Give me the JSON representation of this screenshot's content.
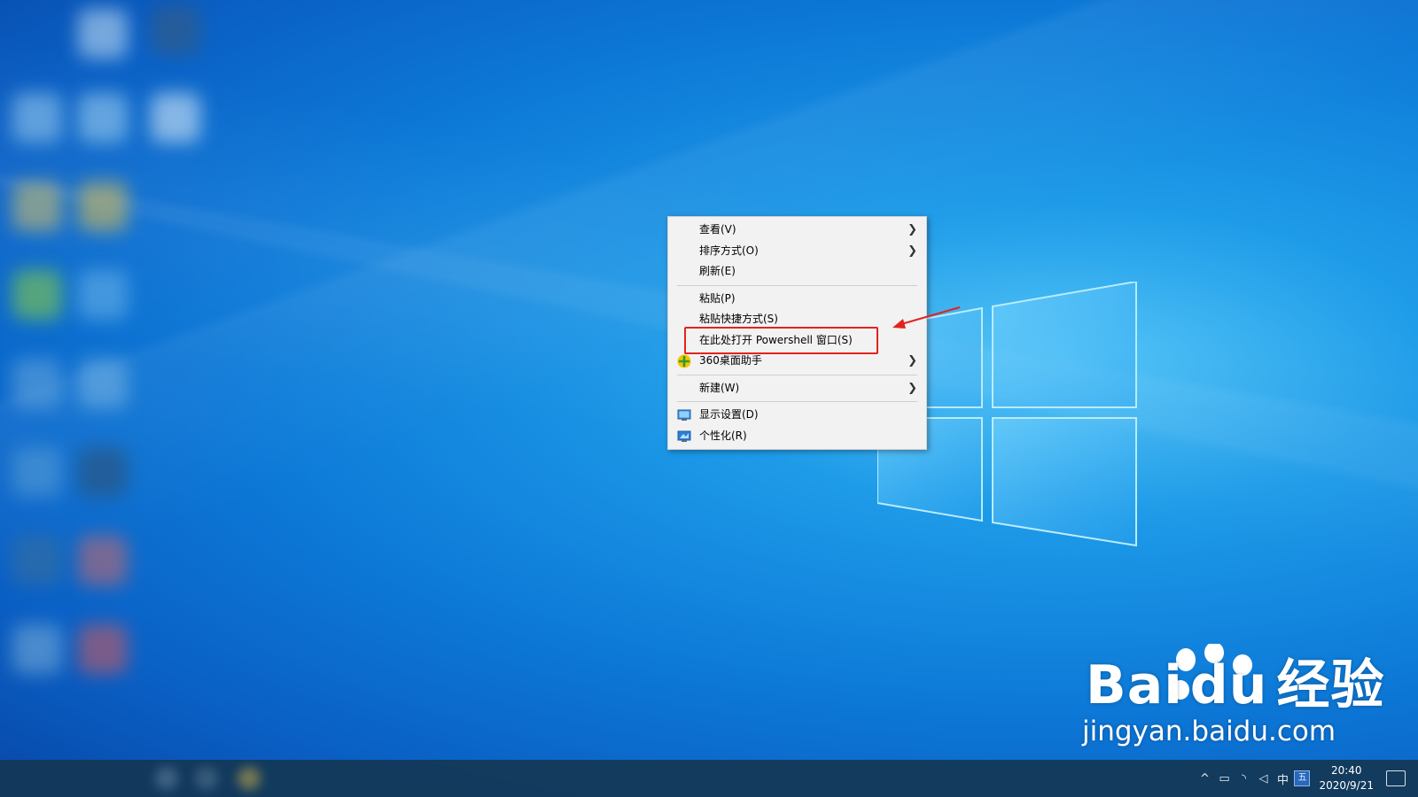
{
  "menu": {
    "items": [
      {
        "label": "查看(V)",
        "submenu": true
      },
      {
        "label": "排序方式(O)",
        "submenu": true
      },
      {
        "label": "刷新(E)",
        "submenu": false
      },
      {
        "label": "粘贴(P)",
        "submenu": false
      },
      {
        "label": "粘贴快捷方式(S)",
        "submenu": false
      },
      {
        "label": "在此处打开 Powershell 窗口(S)",
        "submenu": false
      },
      {
        "label": "360桌面助手",
        "submenu": true,
        "icon": "360-icon"
      },
      {
        "label": "新建(W)",
        "submenu": true
      },
      {
        "label": "显示设置(D)",
        "submenu": false,
        "icon": "display-icon"
      },
      {
        "label": "个性化(R)",
        "submenu": false,
        "icon": "personalize-icon"
      }
    ],
    "submenu_glyph": ">"
  },
  "taskbar": {
    "clock_time": "20:40",
    "clock_date": "2020/9/21",
    "ime_lang": "中",
    "ime_mode": "五"
  },
  "watermark": {
    "brand": "Bai",
    "brand_du": "du",
    "brand_cn": "经验",
    "url": "jingyan.baidu.com"
  },
  "colors": {
    "highlight": "#e3231f",
    "menu_bg": "#f2f2f2"
  }
}
